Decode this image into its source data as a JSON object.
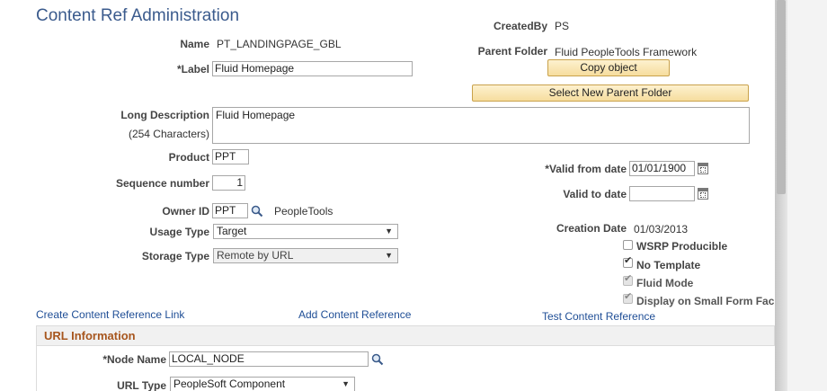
{
  "page_title": "Content Ref Administration",
  "name": {
    "label": "Name",
    "value": "PT_LANDINGPAGE_GBL"
  },
  "label_field": {
    "label": "*Label",
    "value": "Fluid Homepage"
  },
  "created_by": {
    "label": "CreatedBy",
    "value": "PS"
  },
  "parent_folder": {
    "label": "Parent Folder",
    "value": "Fluid PeopleTools  Framework"
  },
  "buttons": {
    "copy_object": "Copy object",
    "select_new_parent_folder": "Select New Parent Folder"
  },
  "long_description": {
    "label": "Long Description",
    "sublabel": "(254 Characters)",
    "value": "Fluid Homepage"
  },
  "product": {
    "label": "Product",
    "value": "PPT"
  },
  "sequence_number": {
    "label": "Sequence number",
    "value": "1"
  },
  "owner_id": {
    "label": "Owner ID",
    "value": "PPT",
    "description": "PeopleTools"
  },
  "usage_type": {
    "label": "Usage Type",
    "value": "Target"
  },
  "storage_type": {
    "label": "Storage Type",
    "value": "Remote by URL"
  },
  "valid_from_date": {
    "label": "*Valid from date",
    "value": "01/01/1900"
  },
  "valid_to_date": {
    "label": "Valid to date",
    "value": ""
  },
  "creation_date": {
    "label": "Creation Date",
    "value": "01/03/2013"
  },
  "checkboxes": [
    {
      "label": "WSRP Producible",
      "checked": false,
      "disabled": false
    },
    {
      "label": "No Template",
      "checked": true,
      "disabled": false
    },
    {
      "label": "Fluid Mode",
      "checked": true,
      "disabled": true
    },
    {
      "label": "Display on Small Form Fac",
      "checked": true,
      "disabled": true
    }
  ],
  "links": {
    "create_content_reference_link": "Create Content Reference Link",
    "add_content_reference": "Add Content Reference",
    "test_content_reference": "Test Content Reference"
  },
  "url_information": {
    "title": "URL Information",
    "node_name": {
      "label": "*Node Name",
      "value": "LOCAL_NODE"
    },
    "url_type": {
      "label": "URL Type",
      "value": "PeopleSoft Component"
    }
  },
  "icons": {
    "lookup": "magnifier",
    "calendar": "calendar",
    "dropdown": "chevron-down",
    "check": "checkmark"
  }
}
